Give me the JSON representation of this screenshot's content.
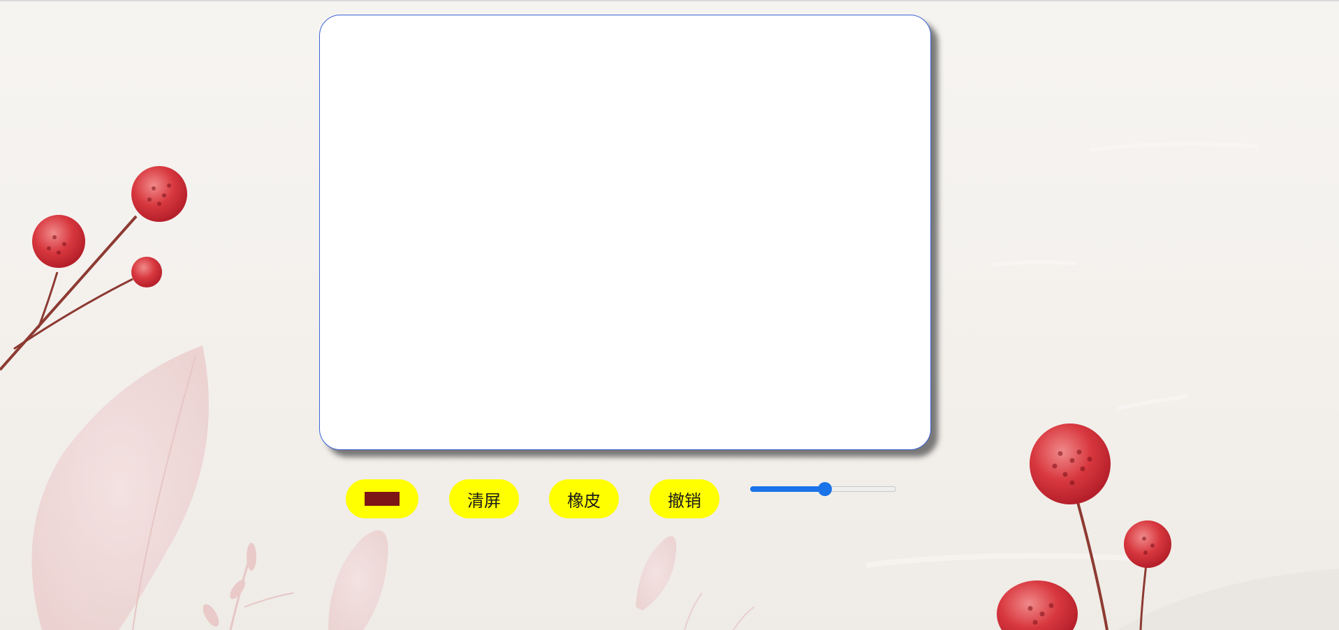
{
  "toolbar": {
    "color_button": {
      "swatch_color": "#7d1616"
    },
    "clear_label": "清屏",
    "eraser_label": "橡皮",
    "undo_label": "撤销",
    "brush_size_slider": {
      "value_fraction": 0.51
    }
  },
  "colors": {
    "button_bg": "#ffff00",
    "board_border": "#3b63d6",
    "slider_accent": "#1a73e8"
  },
  "decor": {
    "icons": [
      "red-berry-branch-icon",
      "pink-leaf-icon",
      "red-flower-icon"
    ]
  }
}
